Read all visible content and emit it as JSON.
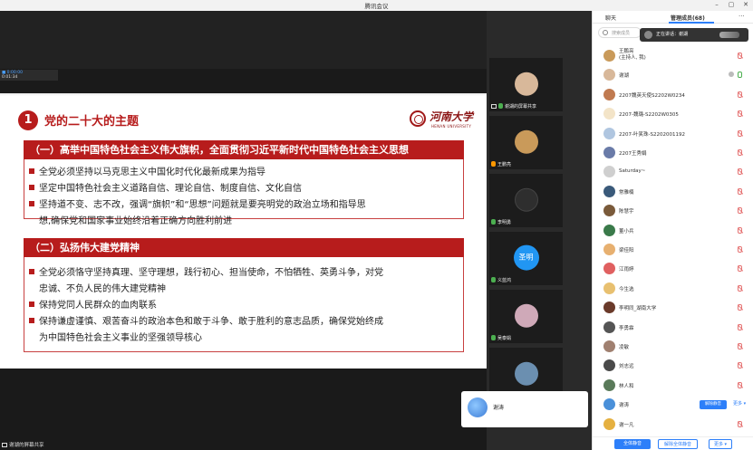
{
  "window": {
    "title": "腾讯会议",
    "controls": [
      "–",
      "▢",
      "✕"
    ]
  },
  "mini_toolbar": {
    "line1": "■ 0:00:00",
    "line2": "0:01:34"
  },
  "slide": {
    "number": "1",
    "title": "党的二十大的主题",
    "logo_cn": "河南大学",
    "logo_en": "HENAN UNIVERSITY",
    "section1": {
      "heading": "（一）高举中国特色社会主义伟大旗帜，全面贯彻习近平新时代中国特色社会主义思想",
      "bullets": [
        "全党必须坚持以马克思主义中国化时代化最新成果为指导",
        "坚定中国特色社会主义道路自信、理论自信、制度自信、文化自信",
        "坚持道不变、志不改，强调“旗帜”和“思想”问题就是要亮明党的政治立场和指导思",
        "想,确保党和国家事业始终沿着正确方向胜利前进"
      ]
    },
    "section2": {
      "heading": "（二）弘扬伟大建党精神",
      "bullets": [
        "全党必须恪守坚持真理、坚守理想，践行初心、担当使命，不怕牺牲、英勇斗争，对党",
        "忠诚、不负人民的伟大建党精神",
        "保持党同人民群众的血肉联系",
        "保持谦虚谨慎、艰苦奋斗的政治本色和敢于斗争、敢于胜利的意志品质，确保党始终成",
        "为中国特色社会主义事业的坚强领导核心"
      ]
    }
  },
  "video_tiles": [
    {
      "label": "谢湖的屏幕共享",
      "avatar_color": "#d8b89a"
    },
    {
      "label": "王鹏亮",
      "avatar_color": "#c99a5a"
    },
    {
      "label": "李明勇",
      "avatar_color": "#2e2e2e"
    },
    {
      "label": "义蓝鸿",
      "avatar_text": "圣明",
      "avatar_color": "#2196f3"
    },
    {
      "label": "吴泰娟",
      "avatar_color": "#cfa9b8"
    },
    {
      "label": "",
      "avatar_color": "#6b8fb0"
    }
  ],
  "self_view": {
    "name": "谢涛"
  },
  "bottom_share_label": "谢湖的屏幕共享",
  "panel": {
    "tab_chat": "聊天",
    "tab_members": "管理成员(68)",
    "more": "···",
    "search_placeholder": "搜索成员",
    "speaking_toast": "正在讲话：谢湖",
    "participants": [
      {
        "name": "王鹏亮\n(主持人, 我)",
        "color": "#c99a5a",
        "mic": "off"
      },
      {
        "name": "谢湖",
        "color": "#d8b89a",
        "mic": "on"
      },
      {
        "name": "2207魏英天使S2202W0234",
        "color": "#c07a50",
        "mic": "off"
      },
      {
        "name": "2207-魏璐-S2202W0305",
        "color": "#f3e4c8",
        "mic": "off"
      },
      {
        "name": "2207-叶笑珠-S2202001192",
        "color": "#b0c6e0",
        "mic": "off"
      },
      {
        "name": "2207王秀娟",
        "color": "#6a7ba8",
        "mic": "off"
      },
      {
        "name": "Saturday~",
        "color": "#cfcfcf",
        "mic": "off"
      },
      {
        "name": "常雅楠",
        "color": "#3a5a7a",
        "mic": "off"
      },
      {
        "name": "陈慧宇",
        "color": "#7a5a3a",
        "mic": "off"
      },
      {
        "name": "董小兵",
        "color": "#3a7a4a",
        "mic": "off"
      },
      {
        "name": "梁佳阳",
        "color": "#e7b070",
        "mic": "off"
      },
      {
        "name": "江雨婷",
        "color": "#e06060",
        "mic": "off"
      },
      {
        "name": "今生选",
        "color": "#e8c070",
        "mic": "off"
      },
      {
        "name": "李明同_湖南大学",
        "color": "#6a3a2a",
        "mic": "off"
      },
      {
        "name": "李勇霖",
        "color": "#555555",
        "mic": "off"
      },
      {
        "name": "凌敏",
        "color": "#a08070",
        "mic": "off"
      },
      {
        "name": "刘志远",
        "color": "#4a4a4a",
        "mic": "off"
      },
      {
        "name": "林人和",
        "color": "#5a7a5a",
        "mic": "off"
      },
      {
        "name": "谢涛",
        "color": "#4a90d9",
        "mic": "off",
        "actions": true
      },
      {
        "name": "谢一凡",
        "color": "#e5b040",
        "mic": "off"
      }
    ],
    "unmute_button": "解除静音",
    "more_link": "更多 ▾",
    "footer_mute_all": "全体静音",
    "footer_unmute_all": "解除全体静音",
    "footer_more": "更多 ▾"
  }
}
